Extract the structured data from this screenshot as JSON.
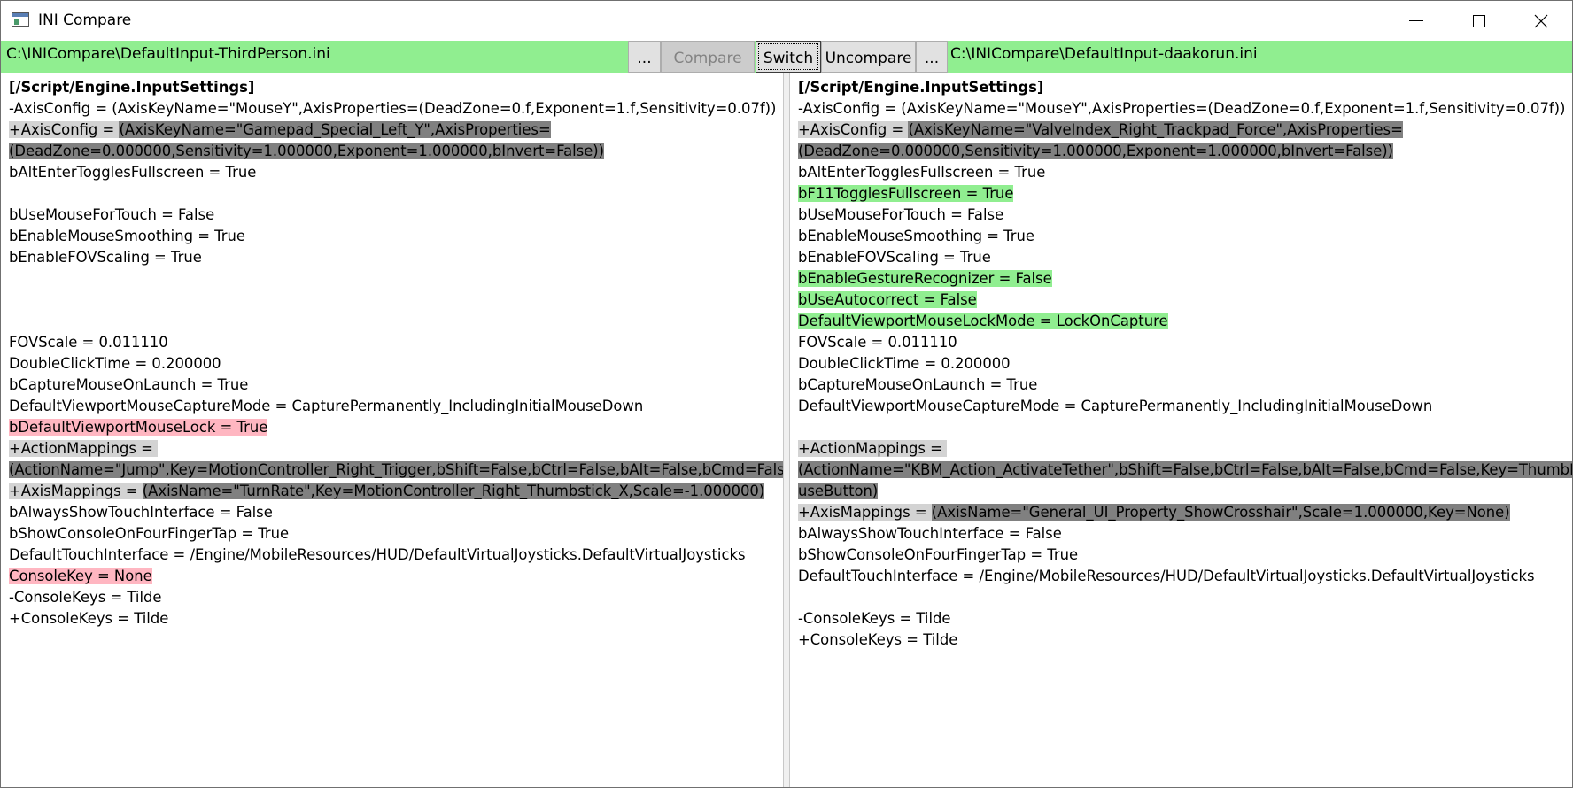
{
  "window": {
    "title": "INI Compare",
    "minimize": "minimize",
    "maximize": "maximize",
    "close": "close"
  },
  "toolbar": {
    "left_path": "C:\\INICompare\\DefaultInput-ThirdPerson.ini",
    "right_path": "C:\\INICompare\\DefaultInput-daakorun.ini",
    "browse_left_label": "...",
    "compare_label": "Compare",
    "switch_label": "Switch",
    "uncompare_label": "Uncompare",
    "browse_right_label": "...",
    "bar_color": "#90ee90"
  },
  "colors": {
    "removed": "#ffb6c1",
    "added": "#90ee90",
    "changed_key": "#d3d3d3",
    "changed_value": "#808080"
  },
  "left_pane": {
    "lines": [
      {
        "segments": [
          {
            "text": "[/Script/Engine.InputSettings]",
            "hl": ""
          }
        ],
        "bold": true
      },
      {
        "segments": [
          {
            "text": "-AxisConfig = (AxisKeyName=\"MouseY\",AxisProperties=(DeadZone=0.f,Exponent=1.f,Sensitivity=0.07f))",
            "hl": ""
          }
        ]
      },
      {
        "segments": [
          {
            "text": "+AxisConfig = ",
            "hl": "grey-l"
          },
          {
            "text": "(AxisKeyName=\"Gamepad_Special_Left_Y\",AxisProperties=",
            "hl": "grey-d"
          }
        ]
      },
      {
        "segments": [
          {
            "text": "(DeadZone=0.000000,Sensitivity=1.000000,Exponent=1.000000,bInvert=False))",
            "hl": "grey-d"
          }
        ]
      },
      {
        "segments": [
          {
            "text": "bAltEnterTogglesFullscreen = True",
            "hl": ""
          }
        ]
      },
      {
        "segments": [
          {
            "text": "",
            "hl": ""
          }
        ]
      },
      {
        "segments": [
          {
            "text": "bUseMouseForTouch = False",
            "hl": ""
          }
        ]
      },
      {
        "segments": [
          {
            "text": "bEnableMouseSmoothing = True",
            "hl": ""
          }
        ]
      },
      {
        "segments": [
          {
            "text": "bEnableFOVScaling = True",
            "hl": ""
          }
        ]
      },
      {
        "segments": [
          {
            "text": "",
            "hl": ""
          }
        ]
      },
      {
        "segments": [
          {
            "text": "",
            "hl": ""
          }
        ]
      },
      {
        "segments": [
          {
            "text": "",
            "hl": ""
          }
        ]
      },
      {
        "segments": [
          {
            "text": "FOVScale = 0.011110",
            "hl": ""
          }
        ]
      },
      {
        "segments": [
          {
            "text": "DoubleClickTime = 0.200000",
            "hl": ""
          }
        ]
      },
      {
        "segments": [
          {
            "text": "bCaptureMouseOnLaunch = True",
            "hl": ""
          }
        ]
      },
      {
        "segments": [
          {
            "text": "DefaultViewportMouseCaptureMode = CapturePermanently_IncludingInitialMouseDown",
            "hl": ""
          }
        ]
      },
      {
        "segments": [
          {
            "text": "bDefaultViewportMouseLock = True",
            "hl": "pink"
          }
        ]
      },
      {
        "segments": [
          {
            "text": "+ActionMappings = ",
            "hl": "grey-l"
          }
        ]
      },
      {
        "segments": [
          {
            "text": "(ActionName=\"Jump\",Key=MotionController_Right_Trigger,bShift=False,bCtrl=False,bAlt=False,bCmd=False)",
            "hl": "grey-d"
          }
        ]
      },
      {
        "segments": [
          {
            "text": "+AxisMappings = ",
            "hl": "grey-l"
          },
          {
            "text": "(AxisName=\"TurnRate\",Key=MotionController_Right_Thumbstick_X,Scale=-1.000000)",
            "hl": "grey-d"
          }
        ]
      },
      {
        "segments": [
          {
            "text": "bAlwaysShowTouchInterface = False",
            "hl": ""
          }
        ]
      },
      {
        "segments": [
          {
            "text": "bShowConsoleOnFourFingerTap = True",
            "hl": ""
          }
        ]
      },
      {
        "segments": [
          {
            "text": "DefaultTouchInterface = /Engine/MobileResources/HUD/DefaultVirtualJoysticks.DefaultVirtualJoysticks",
            "hl": ""
          }
        ]
      },
      {
        "segments": [
          {
            "text": "ConsoleKey = None",
            "hl": "pink"
          }
        ]
      },
      {
        "segments": [
          {
            "text": "-ConsoleKeys = Tilde",
            "hl": ""
          }
        ]
      },
      {
        "segments": [
          {
            "text": "+ConsoleKeys = Tilde",
            "hl": ""
          }
        ]
      }
    ]
  },
  "right_pane": {
    "lines": [
      {
        "segments": [
          {
            "text": "[/Script/Engine.InputSettings]",
            "hl": ""
          }
        ],
        "bold": true
      },
      {
        "segments": [
          {
            "text": "-AxisConfig = (AxisKeyName=\"MouseY\",AxisProperties=(DeadZone=0.f,Exponent=1.f,Sensitivity=0.07f))",
            "hl": ""
          }
        ]
      },
      {
        "segments": [
          {
            "text": "+AxisConfig = ",
            "hl": "grey-l"
          },
          {
            "text": "(AxisKeyName=\"ValveIndex_Right_Trackpad_Force\",AxisProperties=",
            "hl": "grey-d"
          }
        ]
      },
      {
        "segments": [
          {
            "text": "(DeadZone=0.000000,Sensitivity=1.000000,Exponent=1.000000,bInvert=False))",
            "hl": "grey-d"
          }
        ]
      },
      {
        "segments": [
          {
            "text": "bAltEnterTogglesFullscreen = True",
            "hl": ""
          }
        ]
      },
      {
        "segments": [
          {
            "text": "bF11TogglesFullscreen = True",
            "hl": "green"
          }
        ]
      },
      {
        "segments": [
          {
            "text": "bUseMouseForTouch = False",
            "hl": ""
          }
        ]
      },
      {
        "segments": [
          {
            "text": "bEnableMouseSmoothing = True",
            "hl": ""
          }
        ]
      },
      {
        "segments": [
          {
            "text": "bEnableFOVScaling = True",
            "hl": ""
          }
        ]
      },
      {
        "segments": [
          {
            "text": "bEnableGestureRecognizer = False",
            "hl": "green"
          }
        ]
      },
      {
        "segments": [
          {
            "text": "bUseAutocorrect = False",
            "hl": "green"
          }
        ]
      },
      {
        "segments": [
          {
            "text": "DefaultViewportMouseLockMode = LockOnCapture",
            "hl": "green"
          }
        ]
      },
      {
        "segments": [
          {
            "text": "FOVScale = 0.011110",
            "hl": ""
          }
        ]
      },
      {
        "segments": [
          {
            "text": "DoubleClickTime = 0.200000",
            "hl": ""
          }
        ]
      },
      {
        "segments": [
          {
            "text": "bCaptureMouseOnLaunch = True",
            "hl": ""
          }
        ]
      },
      {
        "segments": [
          {
            "text": "DefaultViewportMouseCaptureMode = CapturePermanently_IncludingInitialMouseDown",
            "hl": ""
          }
        ]
      },
      {
        "segments": [
          {
            "text": "",
            "hl": ""
          }
        ]
      },
      {
        "segments": [
          {
            "text": "+ActionMappings = ",
            "hl": "grey-l"
          }
        ]
      },
      {
        "segments": [
          {
            "text": "(ActionName=\"KBM_Action_ActivateTether\",bShift=False,bCtrl=False,bAlt=False,bCmd=False,Key=ThumbMo",
            "hl": "grey-d"
          }
        ]
      },
      {
        "segments": [
          {
            "text": "useButton)",
            "hl": "grey-d"
          }
        ]
      },
      {
        "segments": [
          {
            "text": "+AxisMappings = ",
            "hl": "grey-l"
          },
          {
            "text": "(AxisName=\"General_UI_Property_ShowCrosshair\",Scale=1.000000,Key=None)",
            "hl": "grey-d"
          }
        ]
      },
      {
        "segments": [
          {
            "text": "bAlwaysShowTouchInterface = False",
            "hl": ""
          }
        ]
      },
      {
        "segments": [
          {
            "text": "bShowConsoleOnFourFingerTap = True",
            "hl": ""
          }
        ]
      },
      {
        "segments": [
          {
            "text": "DefaultTouchInterface = /Engine/MobileResources/HUD/DefaultVirtualJoysticks.DefaultVirtualJoysticks",
            "hl": ""
          }
        ]
      },
      {
        "segments": [
          {
            "text": "",
            "hl": ""
          }
        ]
      },
      {
        "segments": [
          {
            "text": "-ConsoleKeys = Tilde",
            "hl": ""
          }
        ]
      },
      {
        "segments": [
          {
            "text": "+ConsoleKeys = Tilde",
            "hl": ""
          }
        ]
      }
    ]
  }
}
